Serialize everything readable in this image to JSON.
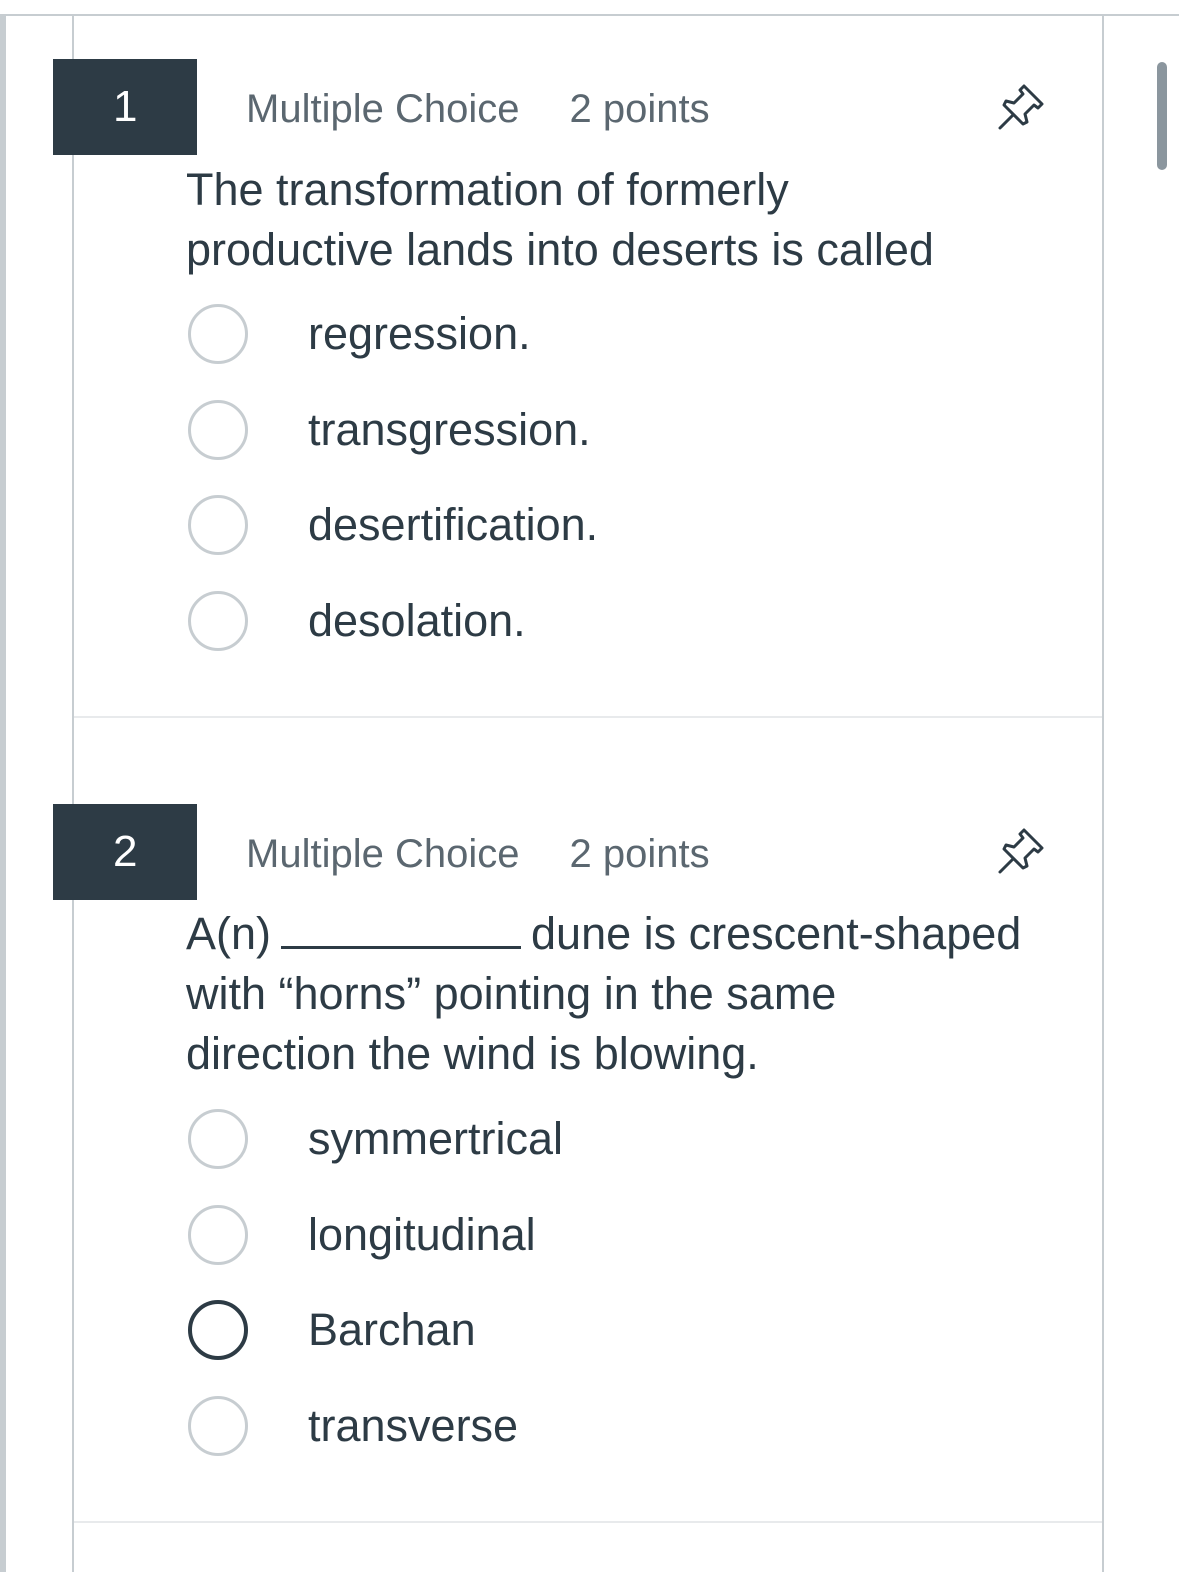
{
  "questions": [
    {
      "number": "1",
      "type": "Multiple Choice",
      "points": "2 points",
      "text_line1": "The transformation of formerly",
      "text_line2": "productive lands into deserts is called",
      "answers": [
        "regression.",
        "transgression.",
        "desertification.",
        "desolation."
      ]
    },
    {
      "number": "2",
      "type": "Multiple Choice",
      "points": "2 points",
      "text_part1": "A(n)",
      "text_part2": "dune is crescent-shaped",
      "text_line2": "with “horns” pointing in the same",
      "text_line3": "direction the wind is blowing.",
      "answers": [
        "symmertrical",
        "longitudinal",
        "Barchan",
        "transverse"
      ],
      "highlighted_answer_index": 2
    }
  ],
  "icons": {
    "pin": "pin-icon"
  },
  "colors": {
    "header_bg": "#2d3b45",
    "muted_text": "#5b6770",
    "border": "#c7cdd1"
  }
}
